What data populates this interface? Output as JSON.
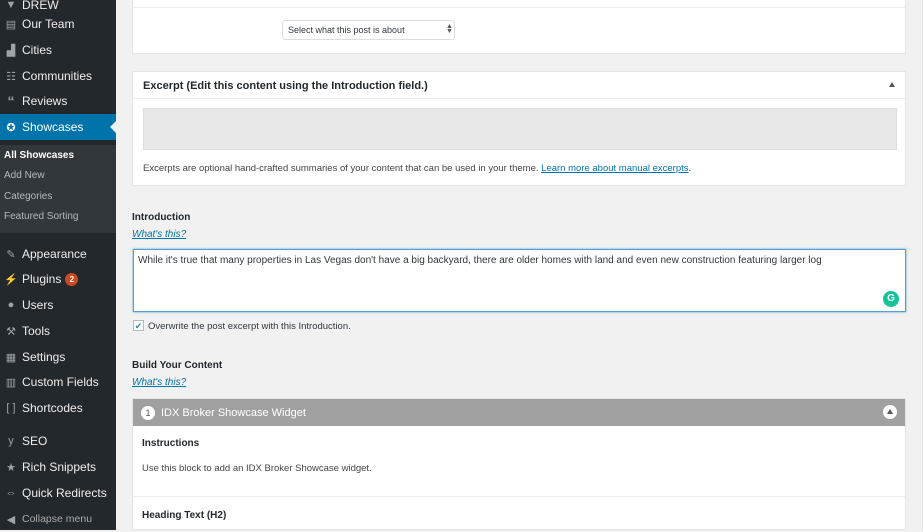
{
  "sidebar": {
    "items": [
      {
        "label": "DREW",
        "icon": "location-pin-icon"
      },
      {
        "label": "Our Team",
        "icon": "id-card-icon"
      },
      {
        "label": "Cities",
        "icon": "city-icon"
      },
      {
        "label": "Communities",
        "icon": "groups-icon"
      },
      {
        "label": "Reviews",
        "icon": "quote-icon"
      },
      {
        "label": "Showcases",
        "icon": "award-icon",
        "active": true
      },
      {
        "label": "Appearance",
        "icon": "paintbrush-icon"
      },
      {
        "label": "Plugins",
        "icon": "plugin-icon",
        "badge": "2"
      },
      {
        "label": "Users",
        "icon": "user-icon"
      },
      {
        "label": "Tools",
        "icon": "wrench-icon"
      },
      {
        "label": "Settings",
        "icon": "settings-icon"
      },
      {
        "label": "Custom Fields",
        "icon": "table-icon"
      },
      {
        "label": "Shortcodes",
        "icon": "brackets-icon"
      },
      {
        "label": "SEO",
        "icon": "yoast-icon"
      },
      {
        "label": "Rich Snippets",
        "icon": "star-icon"
      },
      {
        "label": "Quick Redirects",
        "icon": "redirect-icon"
      },
      {
        "label": "Collapse menu",
        "icon": "collapse-icon"
      }
    ],
    "submenu": [
      "All Showcases",
      "Add New",
      "Categories",
      "Featured Sorting"
    ]
  },
  "topbox": {
    "select_value": "Select what this post is about"
  },
  "excerpt": {
    "title": "Excerpt (Edit this content using the Introduction field.)",
    "value": "",
    "help": "Excerpts are optional hand-crafted summaries of your content that can be used in your theme.",
    "help_link": "Learn more about manual excerpts",
    "help_end": "."
  },
  "introduction": {
    "label": "Introduction",
    "whats_this": "What's this?",
    "value": "While it's true that many properties in Las Vegas don't have a big backyard, there are older homes with land and even new construction featuring larger log",
    "overwrite_label": "Overwrite the post excerpt with this Introduction.",
    "overwrite_checked": true
  },
  "build": {
    "label": "Build Your Content",
    "whats_this": "What's this?",
    "layout": {
      "order": "1",
      "title": "IDX Broker Showcase Widget",
      "instructions_label": "Instructions",
      "instructions_text": "Use this block to add an IDX Broker Showcase widget.",
      "heading_label": "Heading Text (H2)"
    }
  }
}
